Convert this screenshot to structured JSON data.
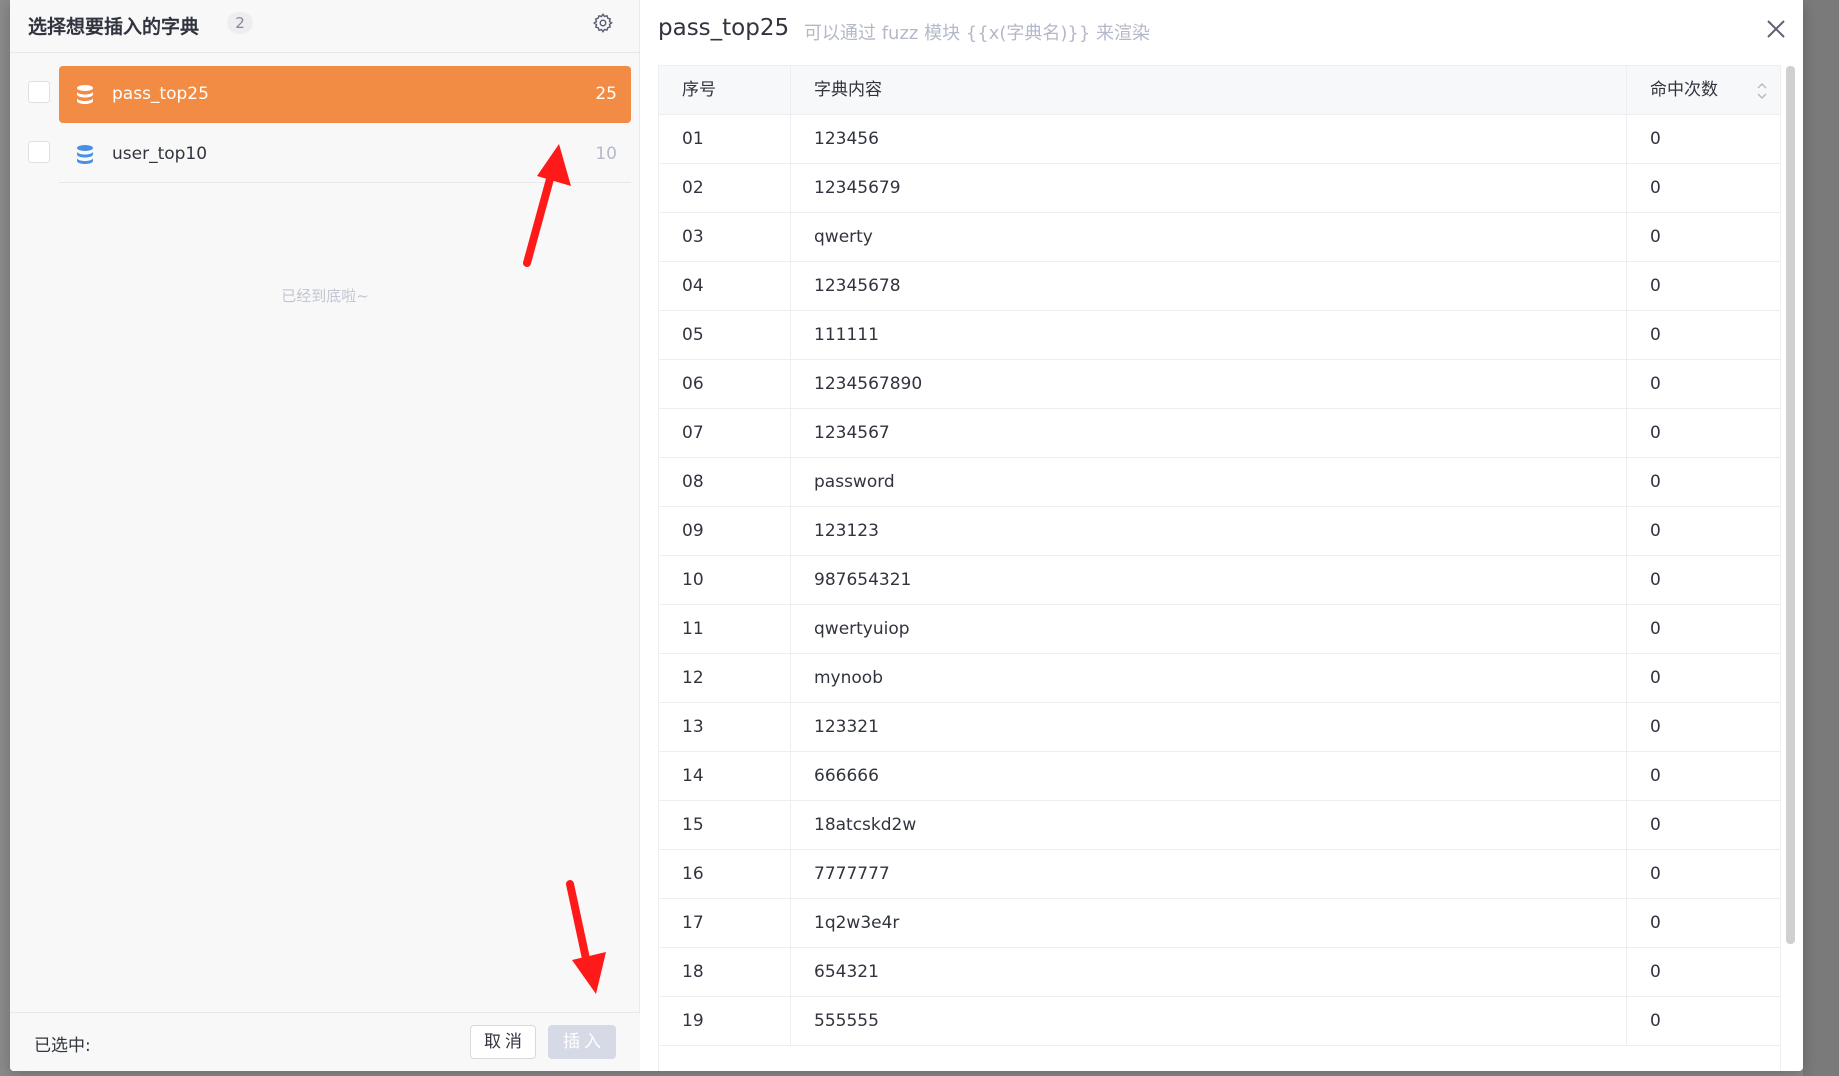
{
  "left_panel": {
    "title": "选择想要插入的字典",
    "count": "2",
    "items": [
      {
        "name": "pass_top25",
        "count": "25",
        "active": true
      },
      {
        "name": "user_top10",
        "count": "10",
        "active": false
      }
    ],
    "end_note": "已经到底啦~",
    "footer": {
      "selected_label": "已选中:",
      "cancel_label": "取消",
      "insert_label": "插入"
    }
  },
  "right_panel": {
    "title": "pass_top25",
    "hint": "可以通过 fuzz 模块 {{x(字典名)}} 来渲染",
    "columns": [
      "序号",
      "字典内容",
      "命中次数"
    ],
    "rows": [
      [
        "01",
        "123456",
        "0"
      ],
      [
        "02",
        "12345679",
        "0"
      ],
      [
        "03",
        "qwerty",
        "0"
      ],
      [
        "04",
        "12345678",
        "0"
      ],
      [
        "05",
        "111111",
        "0"
      ],
      [
        "06",
        "1234567890",
        "0"
      ],
      [
        "07",
        "1234567",
        "0"
      ],
      [
        "08",
        "password",
        "0"
      ],
      [
        "09",
        "123123",
        "0"
      ],
      [
        "10",
        "987654321",
        "0"
      ],
      [
        "11",
        "qwertyuiop",
        "0"
      ],
      [
        "12",
        "mynoob",
        "0"
      ],
      [
        "13",
        "123321",
        "0"
      ],
      [
        "14",
        "666666",
        "0"
      ],
      [
        "15",
        "18atcskd2w",
        "0"
      ],
      [
        "16",
        "7777777",
        "0"
      ],
      [
        "17",
        "1q2w3e4r",
        "0"
      ],
      [
        "18",
        "654321",
        "0"
      ],
      [
        "19",
        "555555",
        "0"
      ]
    ]
  },
  "colors": {
    "accent": "#f28b44",
    "db_icon_blue": "#4a90e2",
    "annotation_red": "#ff1a1a"
  },
  "icons": [
    "gear-icon",
    "database-icon",
    "close-icon",
    "sort-icon"
  ]
}
